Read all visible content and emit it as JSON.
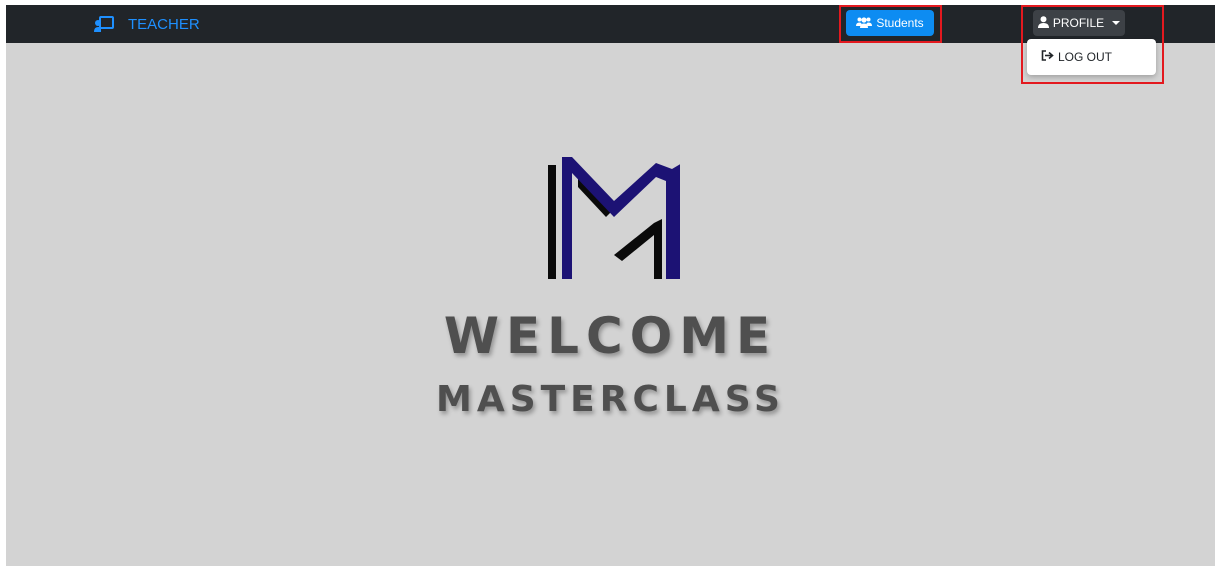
{
  "navbar": {
    "brand_label": "TEACHER",
    "brand_icon": "chalkboard-teacher-icon",
    "students_label": "Students",
    "students_icon": "users-icon",
    "profile_label": "PROFILE",
    "profile_icon": "user-icon"
  },
  "profile_menu": {
    "items": [
      {
        "label": "LOG OUT",
        "icon": "sign-out-icon"
      }
    ]
  },
  "hero": {
    "title": "WELCOME",
    "subtitle": "MASTERCLASS",
    "logo": "masterclass-m-logo"
  },
  "colors": {
    "navbar_bg": "#212529",
    "page_bg": "#d3d3d3",
    "brand_text": "#1e90ff",
    "students_button": "#0d8cf2",
    "profile_button": "#3d4146",
    "highlight": "#e3191f",
    "logo_blue": "#1c1274",
    "logo_black": "#0a0a0a",
    "hero_text": "#4f4f4f"
  }
}
